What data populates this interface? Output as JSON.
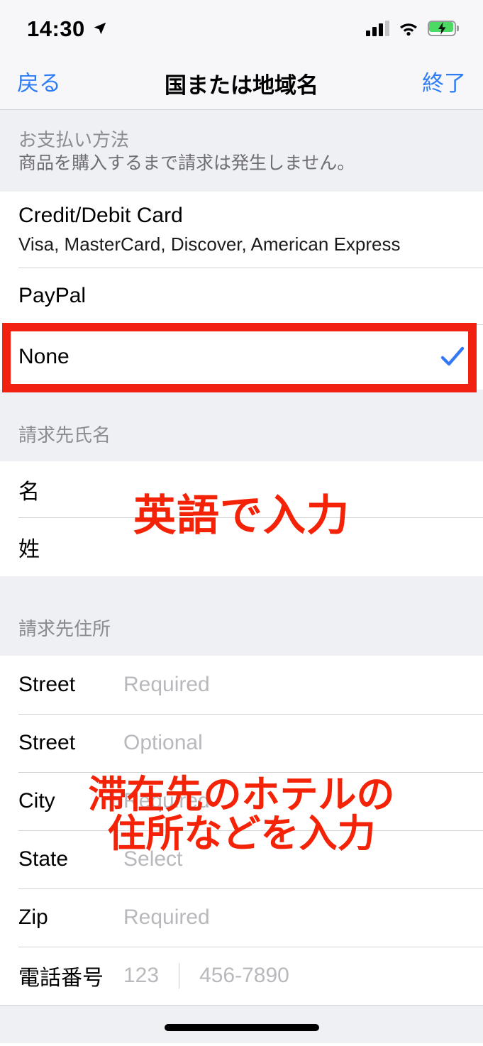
{
  "statusbar": {
    "time": "14:30",
    "location_icon": "location-arrow-icon",
    "signal_icon": "cellular-signal-icon",
    "wifi_icon": "wifi-icon",
    "battery_icon": "battery-charging-icon",
    "battery_color": "#4cd964"
  },
  "navbar": {
    "back_label": "戻る",
    "title": "国または地域名",
    "done_label": "終了",
    "tint_color": "#2d7cf6"
  },
  "payment_section": {
    "header": "お支払い方法",
    "note": "商品を購入するまで請求は発生しません。",
    "options": [
      {
        "title": "Credit/Debit Card",
        "subtitle": "Visa, MasterCard, Discover, American Express",
        "selected": false
      },
      {
        "title": "PayPal",
        "subtitle": "",
        "selected": false
      },
      {
        "title": "None",
        "subtitle": "",
        "selected": true
      }
    ],
    "check_icon": "checkmark-icon",
    "check_color": "#3478f6"
  },
  "billing_name_section": {
    "header": "請求先氏名",
    "rows": [
      {
        "label": "名",
        "placeholder": ""
      },
      {
        "label": "姓",
        "placeholder": ""
      }
    ]
  },
  "billing_address_section": {
    "header": "請求先住所",
    "rows": [
      {
        "label": "Street",
        "placeholder": "Required"
      },
      {
        "label": "Street",
        "placeholder": "Optional"
      },
      {
        "label": "City",
        "placeholder": "Required"
      },
      {
        "label": "State",
        "placeholder": "Select"
      },
      {
        "label": "Zip",
        "placeholder": "Required"
      }
    ],
    "phone_row": {
      "label": "電話番号",
      "area_placeholder": "123",
      "number_placeholder": "456-7890"
    }
  },
  "annotations": {
    "color": "#f42207",
    "highlight_box_target": "None",
    "note_name": "英語で入力",
    "note_address_line1": "滞在先のホテルの",
    "note_address_line2": "住所などを入力"
  }
}
